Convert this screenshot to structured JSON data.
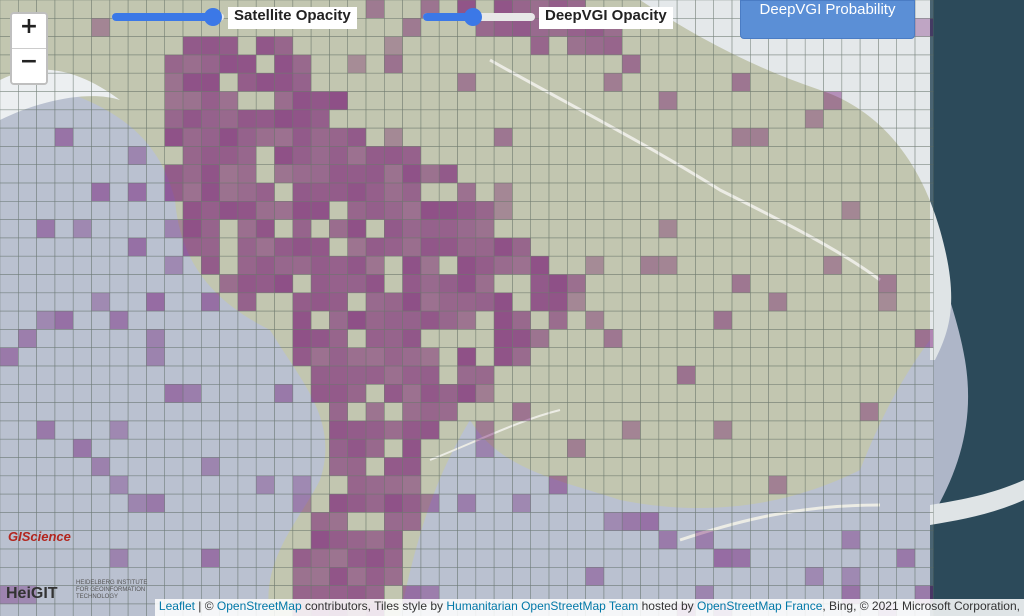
{
  "zoom": {
    "in_label": "+",
    "out_label": "−"
  },
  "sliders": {
    "satellite": {
      "label": "Satellite Opacity",
      "value": 0.9
    },
    "deepvgi": {
      "label": "DeepVGI Opacity",
      "value": 0.45
    }
  },
  "probability_button": {
    "label": "DeepVGI Probability"
  },
  "logos": {
    "giscience": "GIScience",
    "heigit": "HeiGIT",
    "heigit_sub": "HEIDELBERG INSTITUTE FOR GEOINFORMATION TECHNOLOGY"
  },
  "attribution": {
    "leaflet": "Leaflet",
    "sep1": " | © ",
    "osm": "OpenStreetMap",
    "t1": " contributors, Tiles style by ",
    "hot": "Humanitarian OpenStreetMap Team",
    "t2": " hosted by ",
    "osmfr": "OpenStreetMap France",
    "t3": ", Bing, © 2021 Microsoft Corporation,"
  },
  "colors": {
    "overlay": "#7a1a7a",
    "grid": "#5d6b62",
    "sea": "#aeb6c8",
    "land": "#b8bca2",
    "slider": "#3b78e7",
    "button": "#5b8fd6"
  }
}
